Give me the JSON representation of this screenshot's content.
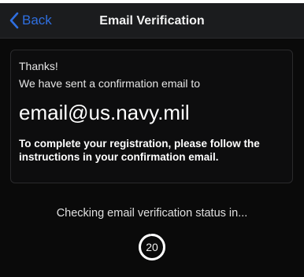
{
  "nav": {
    "back_label": "Back",
    "title": "Email Verification"
  },
  "message": {
    "thanks": "Thanks!",
    "sent_line": "We have sent a confirmation email to",
    "email": "email@us.navy.mil",
    "instructions": "To complete your registration, please follow the instructions in your confirmation email."
  },
  "status": {
    "checking_text": "Checking email verification status in...",
    "countdown_value": "20",
    "countdown_progress": 0.97
  },
  "colors": {
    "accent": "#2f6fe0",
    "background": "#0a0a0a",
    "navbar": "#1b1c1e"
  },
  "icons": {
    "back": "chevron-left-icon"
  }
}
